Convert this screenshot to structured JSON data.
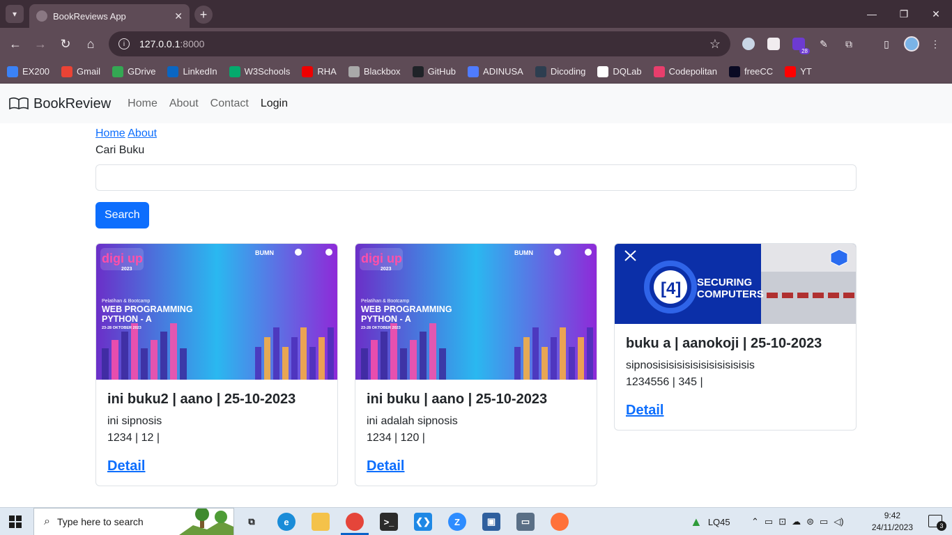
{
  "browser": {
    "tab_title": "BookReviews App",
    "url_host": "127.0.0.1",
    "url_port": ":8000",
    "extension_badge": "28",
    "bookmarks": [
      {
        "label": "EX200",
        "color": "#3b82f6"
      },
      {
        "label": "Gmail",
        "color": "#ea4335"
      },
      {
        "label": "GDrive",
        "color": "#34a853"
      },
      {
        "label": "LinkedIn",
        "color": "#0a66c2"
      },
      {
        "label": "W3Schools",
        "color": "#04aa6d"
      },
      {
        "label": "RHA",
        "color": "#ee0000"
      },
      {
        "label": "Blackbox",
        "color": "#a9a9a9"
      },
      {
        "label": "GitHub",
        "color": "#1f2328"
      },
      {
        "label": "ADINUSA",
        "color": "#4f7cff"
      },
      {
        "label": "Dicoding",
        "color": "#2d3e50"
      },
      {
        "label": "DQLab",
        "color": "#ffffff"
      },
      {
        "label": "Codepolitan",
        "color": "#e83e6c"
      },
      {
        "label": "freeCC",
        "color": "#0a0a23"
      },
      {
        "label": "YT",
        "color": "#ff0000"
      }
    ]
  },
  "navbar": {
    "brand": "BookReview",
    "links": [
      "Home",
      "About",
      "Contact",
      "Login"
    ]
  },
  "breadcrumb": {
    "home": "Home",
    "about": "About"
  },
  "search": {
    "label": "Cari Buku",
    "button": "Search",
    "value": ""
  },
  "books": [
    {
      "title": "ini buku2 | aano | 25-10-2023",
      "synopsis": "ini sipnosis",
      "meta": "1234 | 12 |",
      "link": "Detail",
      "cover": {
        "type": "digiup",
        "line1": "Pelatihan & Bootcamp",
        "line2": "WEB PROGRAMMING",
        "line3": "PYTHON - A",
        "line4": "23-28 OKTOBER 2023",
        "logo": "digi up",
        "logo_year": "2023",
        "sponsor": "BUMN"
      }
    },
    {
      "title": "ini buku | aano | 25-10-2023",
      "synopsis": "ini adalah sipnosis",
      "meta": "1234 | 120 |",
      "link": "Detail",
      "cover": {
        "type": "digiup",
        "line1": "Pelatihan & Bootcamp",
        "line2": "WEB PROGRAMMING",
        "line3": "PYTHON - A",
        "line4": "23-28 OKTOBER 2023",
        "logo": "digi up",
        "logo_year": "2023",
        "sponsor": "BUMN"
      }
    },
    {
      "title": "buku a | aanokoji | 25-10-2023",
      "synopsis": "sipnosisisisisisisisisisisisis",
      "meta": "1234556 | 345 |",
      "link": "Detail",
      "cover": {
        "type": "securing",
        "number": "[4]",
        "line1": "SECURING",
        "line2": "COMPUTERS"
      }
    }
  ],
  "taskbar": {
    "search_placeholder": "Type here to search",
    "network": "LQ45",
    "time": "9:42",
    "date": "24/11/2023",
    "notifications": "3"
  }
}
